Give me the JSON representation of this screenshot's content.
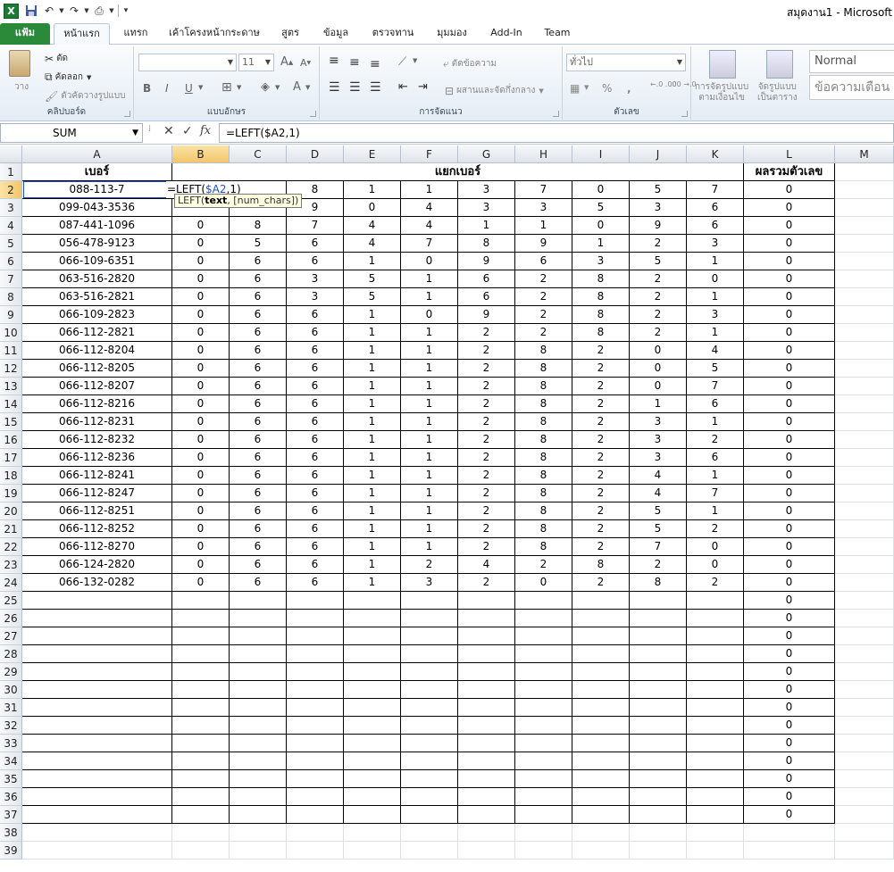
{
  "title": "สมุดงาน1 - Microsoft",
  "ribbon_tabs": [
    {
      "label": "แฟ้ม",
      "style": "file"
    },
    {
      "label": "หน้าแรก",
      "style": "active"
    },
    {
      "label": "แทรก"
    },
    {
      "label": "เค้าโครงหน้ากระดาษ"
    },
    {
      "label": "สูตร"
    },
    {
      "label": "ข้อมูล"
    },
    {
      "label": "ตรวจทาน"
    },
    {
      "label": "มุมมอง"
    },
    {
      "label": "Add-In"
    },
    {
      "label": "Team"
    }
  ],
  "ribbon": {
    "clipboard": {
      "label": "คลิปบอร์ด",
      "paste": "วาง",
      "cut": "ตัด",
      "copy": "คัดลอก",
      "format_painter": "ตัวคัดวางรูปแบบ"
    },
    "font": {
      "label": "แบบอักษร",
      "font_name": "",
      "font_size": "11",
      "bold": "B",
      "italic": "I",
      "underline": "U"
    },
    "alignment": {
      "label": "การจัดแนว",
      "wrap_text": "ตัดข้อความ",
      "merge_center": "ผสานและจัดกึ่งกลาง"
    },
    "number": {
      "label": "ตัวเลข",
      "format": "ทั่วไป",
      "percent": "%",
      "comma": ",",
      "inc_decimal": "←.0 .00",
      "dec_decimal": ".00 →.0"
    },
    "styles": {
      "conditional_formatting": [
        "การจัดรูปแบบ",
        "ตามเงื่อนไข"
      ],
      "format_as_table": [
        "จัดรูปแบบ",
        "เป็นตาราง"
      ],
      "normal": "Normal",
      "warning_text": "ข้อความเตือน"
    }
  },
  "formula_bar": {
    "name_box": "SUM",
    "formula": "=LEFT($A2,1)",
    "cancel": "✕",
    "enter": "✓",
    "fx": "fx"
  },
  "sheet": {
    "columns": [
      "A",
      "B",
      "C",
      "D",
      "E",
      "F",
      "G",
      "H",
      "I",
      "J",
      "K",
      "L",
      "M"
    ],
    "selected_column": "B",
    "selected_row": 2,
    "row_numbers": [
      1,
      2,
      3,
      4,
      5,
      6,
      7,
      8,
      9,
      10,
      11,
      12,
      13,
      14,
      15,
      16,
      17,
      18,
      19,
      20,
      21,
      22,
      23,
      24,
      25,
      26,
      27,
      28,
      29,
      30,
      31,
      32,
      33,
      34,
      35,
      36,
      37,
      38,
      39
    ],
    "headers": {
      "a1": "เบอร์",
      "split": "แยกเบอร์",
      "sum": "ผลรวมตัวเลข"
    },
    "rows": [
      {
        "phone": "088-113-7",
        "digits": [
          "",
          "",
          "8",
          "1",
          "1",
          "3",
          "7",
          "0",
          "5",
          "7"
        ],
        "sum": "0"
      },
      {
        "phone": "099-043-3536",
        "digits": [
          "",
          "",
          "9",
          "0",
          "4",
          "3",
          "3",
          "5",
          "3",
          "6"
        ],
        "sum": "0"
      },
      {
        "phone": "087-441-1096",
        "digits": [
          "0",
          "8",
          "7",
          "4",
          "4",
          "1",
          "1",
          "0",
          "9",
          "6"
        ],
        "sum": "0"
      },
      {
        "phone": "056-478-9123",
        "digits": [
          "0",
          "5",
          "6",
          "4",
          "7",
          "8",
          "9",
          "1",
          "2",
          "3"
        ],
        "sum": "0"
      },
      {
        "phone": "066-109-6351",
        "digits": [
          "0",
          "6",
          "6",
          "1",
          "0",
          "9",
          "6",
          "3",
          "5",
          "1"
        ],
        "sum": "0"
      },
      {
        "phone": "063-516-2820",
        "digits": [
          "0",
          "6",
          "3",
          "5",
          "1",
          "6",
          "2",
          "8",
          "2",
          "0"
        ],
        "sum": "0"
      },
      {
        "phone": "063-516-2821",
        "digits": [
          "0",
          "6",
          "3",
          "5",
          "1",
          "6",
          "2",
          "8",
          "2",
          "1"
        ],
        "sum": "0"
      },
      {
        "phone": "066-109-2823",
        "digits": [
          "0",
          "6",
          "6",
          "1",
          "0",
          "9",
          "2",
          "8",
          "2",
          "3"
        ],
        "sum": "0"
      },
      {
        "phone": "066-112-2821",
        "digits": [
          "0",
          "6",
          "6",
          "1",
          "1",
          "2",
          "2",
          "8",
          "2",
          "1"
        ],
        "sum": "0"
      },
      {
        "phone": "066-112-8204",
        "digits": [
          "0",
          "6",
          "6",
          "1",
          "1",
          "2",
          "8",
          "2",
          "0",
          "4"
        ],
        "sum": "0"
      },
      {
        "phone": "066-112-8205",
        "digits": [
          "0",
          "6",
          "6",
          "1",
          "1",
          "2",
          "8",
          "2",
          "0",
          "5"
        ],
        "sum": "0"
      },
      {
        "phone": "066-112-8207",
        "digits": [
          "0",
          "6",
          "6",
          "1",
          "1",
          "2",
          "8",
          "2",
          "0",
          "7"
        ],
        "sum": "0"
      },
      {
        "phone": "066-112-8216",
        "digits": [
          "0",
          "6",
          "6",
          "1",
          "1",
          "2",
          "8",
          "2",
          "1",
          "6"
        ],
        "sum": "0"
      },
      {
        "phone": "066-112-8231",
        "digits": [
          "0",
          "6",
          "6",
          "1",
          "1",
          "2",
          "8",
          "2",
          "3",
          "1"
        ],
        "sum": "0"
      },
      {
        "phone": "066-112-8232",
        "digits": [
          "0",
          "6",
          "6",
          "1",
          "1",
          "2",
          "8",
          "2",
          "3",
          "2"
        ],
        "sum": "0"
      },
      {
        "phone": "066-112-8236",
        "digits": [
          "0",
          "6",
          "6",
          "1",
          "1",
          "2",
          "8",
          "2",
          "3",
          "6"
        ],
        "sum": "0"
      },
      {
        "phone": "066-112-8241",
        "digits": [
          "0",
          "6",
          "6",
          "1",
          "1",
          "2",
          "8",
          "2",
          "4",
          "1"
        ],
        "sum": "0"
      },
      {
        "phone": "066-112-8247",
        "digits": [
          "0",
          "6",
          "6",
          "1",
          "1",
          "2",
          "8",
          "2",
          "4",
          "7"
        ],
        "sum": "0"
      },
      {
        "phone": "066-112-8251",
        "digits": [
          "0",
          "6",
          "6",
          "1",
          "1",
          "2",
          "8",
          "2",
          "5",
          "1"
        ],
        "sum": "0"
      },
      {
        "phone": "066-112-8252",
        "digits": [
          "0",
          "6",
          "6",
          "1",
          "1",
          "2",
          "8",
          "2",
          "5",
          "2"
        ],
        "sum": "0"
      },
      {
        "phone": "066-112-8270",
        "digits": [
          "0",
          "6",
          "6",
          "1",
          "1",
          "2",
          "8",
          "2",
          "7",
          "0"
        ],
        "sum": "0"
      },
      {
        "phone": "066-124-2820",
        "digits": [
          "0",
          "6",
          "6",
          "1",
          "2",
          "4",
          "2",
          "8",
          "2",
          "0"
        ],
        "sum": "0"
      },
      {
        "phone": "066-132-0282",
        "digits": [
          "0",
          "6",
          "6",
          "1",
          "3",
          "2",
          "0",
          "2",
          "8",
          "2"
        ],
        "sum": "0"
      }
    ],
    "empty_sum_rows": [
      "0",
      "0",
      "0",
      "0",
      "0",
      "0",
      "0",
      "0",
      "0",
      "0",
      "0",
      "0",
      "0"
    ],
    "edit_cell": {
      "prefix": "=LEFT(",
      "ref": "$A2",
      "suffix": ",1)"
    },
    "tooltip": {
      "fn": "LEFT(",
      "arg1": "text",
      "rest": ", [num_chars])"
    }
  }
}
